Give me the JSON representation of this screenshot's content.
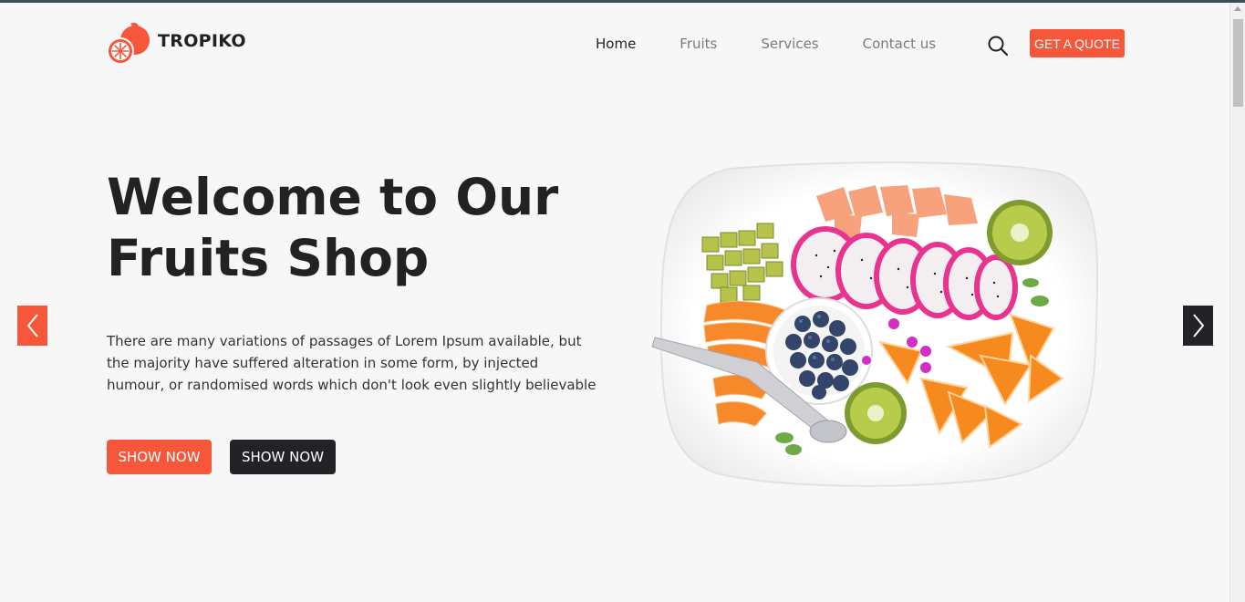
{
  "brand": {
    "name": "TROPIKO",
    "logo_icon": "orange-fruit-icon"
  },
  "nav": {
    "items": [
      {
        "label": "Home",
        "active": true
      },
      {
        "label": "Fruits",
        "active": false
      },
      {
        "label": "Services",
        "active": false
      },
      {
        "label": "Contact us",
        "active": false
      }
    ]
  },
  "header": {
    "search_icon": "search-icon",
    "quote_label": "GET A QUOTE"
  },
  "hero": {
    "title_line1": "Welcome to Our",
    "title_line2": "Fruits Shop",
    "text": "There are many variations of passages of Lorem Ipsum available, but the majority have suffered alteration in some form, by injected humour, or randomised words which don't look even slightly believable",
    "primary_button": "SHOW NOW",
    "secondary_button": "SHOW NOW",
    "image_alt": "fruit-plate-image"
  },
  "slider": {
    "prev_icon": "chevron-left-icon",
    "next_icon": "chevron-right-icon"
  },
  "colors": {
    "accent": "#f6573b",
    "dark": "#232327",
    "background": "#f7f7f7"
  }
}
